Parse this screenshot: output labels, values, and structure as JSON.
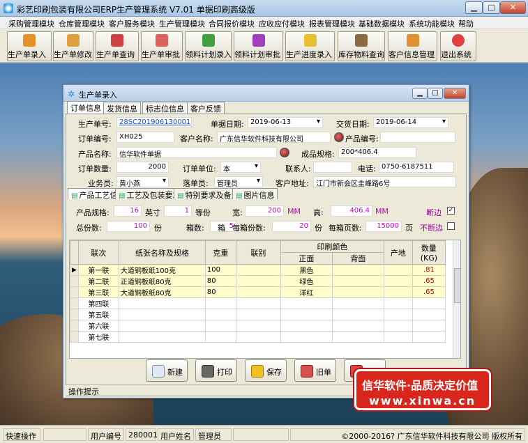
{
  "window": {
    "title": "彩艺印刷包装有限公司ERP生产管理系统  V7.01 单据印刷高级版"
  },
  "menu": [
    "采购管理模块",
    "仓库管理模块",
    "客户服务模块",
    "生产管理模块",
    "合同报价模块",
    "应收应付模块",
    "报表管理模块",
    "基础数据模块",
    "系统功能模块",
    "帮助"
  ],
  "toolbar": [
    {
      "label": "生产单录入",
      "icon": "box-icon",
      "color": "#e8902a"
    },
    {
      "label": "生产单修改",
      "icon": "box-edit-icon",
      "color": "#e0a040"
    },
    {
      "label": "生产单查询",
      "icon": "search-box-icon",
      "color": "#d04040"
    },
    {
      "label": "生产单审批",
      "icon": "approve-icon",
      "color": "#e06060"
    },
    {
      "label": "领料计划录入",
      "icon": "material-icon",
      "color": "#40a040"
    },
    {
      "label": "领料计划审批",
      "icon": "material-approve-icon",
      "color": "#a040c0"
    },
    {
      "label": "生产进度录入",
      "icon": "progress-icon",
      "color": "#e8c030"
    },
    {
      "label": "库存物料查询",
      "icon": "inventory-icon",
      "color": "#8a6a40"
    },
    {
      "label": "客户信息管理",
      "icon": "customer-icon",
      "color": "#e09030"
    },
    {
      "label": "退出系统",
      "icon": "exit-icon",
      "color": "#e04040"
    }
  ],
  "child": {
    "title": "生产单录入",
    "tabs": [
      "订单信息",
      "发货信息",
      "标志位信息",
      "客户反馈"
    ],
    "order": {
      "prod_no_label": "生产单号:",
      "prod_no": "28SC201906130001",
      "date_label": "单据日期:",
      "date": "2019-06-13",
      "delivery_label": "交货日期:",
      "delivery": "2019-06-14",
      "order_no_label": "订单编号:",
      "order_no": "XH025",
      "customer_label": "客户名称:",
      "customer": "广东信华软件科技有限公司",
      "product_code_label": "产品编号:",
      "product_code": "",
      "product_name_label": "产品名称:",
      "product_name": "信华软件单据",
      "spec_label": "成品规格:",
      "spec": "200*406.4",
      "qty_label": "订单数量:",
      "qty": "2000",
      "unit_label": "订单单位:",
      "unit": "本",
      "contact_label": "联系人:",
      "contact": "",
      "phone_label": "电话:",
      "phone": "0750-6187511",
      "sales_label": "业务员:",
      "sales": "黄小燕",
      "clerk_label": "落单员:",
      "clerk": "管理员",
      "address_label": "客户地址:",
      "address": "江门市新会区圭峰路6号"
    },
    "subtabs": [
      "产品工艺信息",
      "工艺及包装要求",
      "特别要求及备注",
      "图片信息"
    ],
    "craft": {
      "spec_label": "产品规格:",
      "spec_val": "16",
      "unit1": "英寸",
      "val2": "1",
      "unit2": "等份",
      "width_label": "宽:",
      "width": "200",
      "width_unit": "MM",
      "height_label": "高:",
      "height": "406.4",
      "height_unit": "MM",
      "cut_label": "断边",
      "cut_checked": "✓",
      "total_label": "总份数:",
      "total": "100",
      "total_unit": "份",
      "box_label": "箱数:",
      "box": "5",
      "box_unit": "箱",
      "per_box_label": "每箱份数:",
      "per_box": "20",
      "per_box_unit": "份",
      "pages_label": "每箱页数:",
      "pages": "15000",
      "pages_unit": "页",
      "nocut_label": "不断边",
      "nocut_checked": ""
    },
    "grid": {
      "headers": [
        "联次",
        "纸张名称及规格",
        "克重",
        "联别",
        "印刷颜色",
        "产地",
        "数量(KG)"
      ],
      "color_sub": [
        "正面",
        "背面"
      ],
      "rows": [
        {
          "lian": "第一联",
          "paper": "大道铜板纸100克",
          "weight": "100",
          "type": "",
          "front": "黑色",
          "back": "",
          "origin": "",
          "qty": ".81"
        },
        {
          "lian": "第二联",
          "paper": "正道铜板纸80克",
          "weight": "80",
          "type": "",
          "front": "绿色",
          "back": "",
          "origin": "",
          "qty": ".65"
        },
        {
          "lian": "第三联",
          "paper": "大道铜板纸80克",
          "weight": "80",
          "type": "",
          "front": "洋红",
          "back": "",
          "origin": "",
          "qty": ".65"
        },
        {
          "lian": "第四联",
          "paper": "",
          "weight": "",
          "type": "",
          "front": "",
          "back": "",
          "origin": "",
          "qty": ""
        },
        {
          "lian": "第五联",
          "paper": "",
          "weight": "",
          "type": "",
          "front": "",
          "back": "",
          "origin": "",
          "qty": ""
        },
        {
          "lian": "第六联",
          "paper": "",
          "weight": "",
          "type": "",
          "front": "",
          "back": "",
          "origin": "",
          "qty": ""
        },
        {
          "lian": "第七联",
          "paper": "",
          "weight": "",
          "type": "",
          "front": "",
          "back": "",
          "origin": "",
          "qty": ""
        }
      ],
      "row_marker": "▶"
    },
    "actions": [
      "新建",
      "打印",
      "保存",
      "旧单",
      "关闭"
    ],
    "hint": "操作提示"
  },
  "status": {
    "quick": "快速操作",
    "user_no_label": "用户编号",
    "user_no": "280001",
    "user_name_label": "用户姓名",
    "user_name": "管理员",
    "copyright": "©2000-2016?  广东信华软件科技有限公司  版权所有"
  },
  "brand": {
    "line1": "信华软件·品质决定价值",
    "line2": "www.xinwa.cn"
  }
}
